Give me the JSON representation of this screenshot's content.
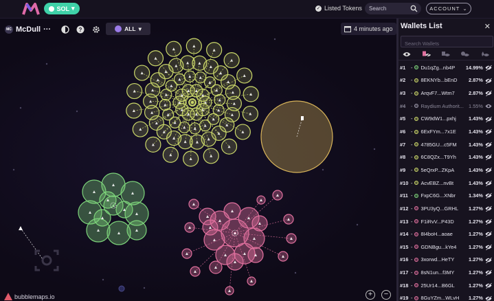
{
  "topbar": {
    "logo": "bubblemaps-logo-icon",
    "chain_label": "SOL",
    "listed_tokens_label": "Listed Tokens",
    "search_placeholder": "Search",
    "account_label": "ACCOUNT"
  },
  "map": {
    "token_name": "McDull",
    "token_avatar_text": "MC",
    "more_label": "···",
    "filter_label": "ALL",
    "updated_label": "4 minutes ago",
    "brand_label": "bubblemaps.io",
    "colors": {
      "green": "#7dd37a",
      "olive": "#cbd86a",
      "gold": "#d8b45a",
      "pink": "#e0709e",
      "background": "#0f0b18"
    }
  },
  "panel": {
    "title": "Wallets List",
    "search_placeholder": "Search Wallets",
    "tab_icons": [
      "eye-icon",
      "eye-off-icon",
      "eye-off-icon",
      "eye-off-icon",
      "eye-off-icon"
    ],
    "wallets": [
      {
        "rank": "#1",
        "address": "Du1qZg...nb4P",
        "percent": "14.99%",
        "color": "#7dd37a",
        "dim": false
      },
      {
        "rank": "#2",
        "address": "8EKNYb...bEnD",
        "percent": "2.87%",
        "color": "#cbd86a",
        "dim": false
      },
      {
        "rank": "#3",
        "address": "ArqvF7...Wtm7",
        "percent": "2.87%",
        "color": "#cbd86a",
        "dim": false
      },
      {
        "rank": "#4",
        "address": "Raydium Authorit...",
        "percent": "1.55%",
        "color": "#9a96a8",
        "dim": true
      },
      {
        "rank": "#5",
        "address": "CW9dW1...pxhj",
        "percent": "1.43%",
        "color": "#cbd86a",
        "dim": false
      },
      {
        "rank": "#6",
        "address": "6ExFYm...7x1E",
        "percent": "1.43%",
        "color": "#cbd86a",
        "dim": false
      },
      {
        "rank": "#7",
        "address": "4785GU...c5FM",
        "percent": "1.43%",
        "color": "#cbd86a",
        "dim": false
      },
      {
        "rank": "#8",
        "address": "6C8QZx...T9Yh",
        "percent": "1.43%",
        "color": "#cbd86a",
        "dim": false
      },
      {
        "rank": "#9",
        "address": "5eQrxP...ZKpA",
        "percent": "1.43%",
        "color": "#cbd86a",
        "dim": false
      },
      {
        "rank": "#10",
        "address": "AcvEBZ...nvBt",
        "percent": "1.43%",
        "color": "#cbd86a",
        "dim": false
      },
      {
        "rank": "#11",
        "address": "FxpC6G...XNbr",
        "percent": "1.34%",
        "color": "#7dd37a",
        "dim": false
      },
      {
        "rank": "#12",
        "address": "3PU3yQ...GRHL",
        "percent": "1.27%",
        "color": "#e0709e",
        "dim": false
      },
      {
        "rank": "#13",
        "address": "F1iRvV...P43D",
        "percent": "1.27%",
        "color": "#e0709e",
        "dim": false
      },
      {
        "rank": "#14",
        "address": "8I4boH...aoae",
        "percent": "1.27%",
        "color": "#e0709e",
        "dim": false
      },
      {
        "rank": "#15",
        "address": "GDNBgu...kYe4",
        "percent": "1.27%",
        "color": "#e0709e",
        "dim": false
      },
      {
        "rank": "#16",
        "address": "3xorwd...HeTY",
        "percent": "1.27%",
        "color": "#e0709e",
        "dim": false
      },
      {
        "rank": "#17",
        "address": "8sN1un...f3MY",
        "percent": "1.27%",
        "color": "#e0709e",
        "dim": false
      },
      {
        "rank": "#18",
        "address": "25Ur14...B6GL",
        "percent": "1.27%",
        "color": "#e0709e",
        "dim": false
      },
      {
        "rank": "#19",
        "address": "8GuYZm...WLvH",
        "percent": "1.27%",
        "color": "#e0709e",
        "dim": false
      }
    ]
  }
}
